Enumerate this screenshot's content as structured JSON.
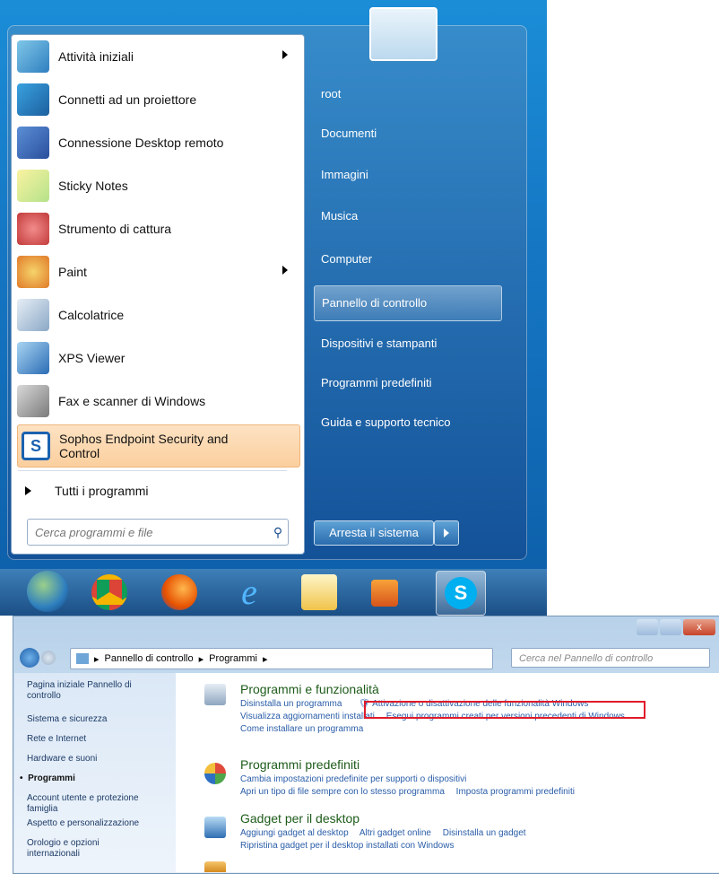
{
  "start_menu": {
    "programs": [
      {
        "label": "Attività iniziali",
        "submenu": true
      },
      {
        "label": "Connetti ad un proiettore",
        "submenu": false
      },
      {
        "label": "Connessione Desktop remoto",
        "submenu": false
      },
      {
        "label": "Sticky Notes",
        "submenu": false
      },
      {
        "label": "Strumento di cattura",
        "submenu": false
      },
      {
        "label": "Paint",
        "submenu": true
      },
      {
        "label": "Calcolatrice",
        "submenu": false
      },
      {
        "label": "XPS Viewer",
        "submenu": false
      },
      {
        "label": "Fax e scanner di Windows",
        "submenu": false
      },
      {
        "label": "Sophos Endpoint Security and Control",
        "submenu": false
      }
    ],
    "all_programs_label": "Tutti i programmi",
    "search_placeholder": "Cerca programmi e file",
    "right_items": [
      "root",
      "Documenti",
      "Immagini",
      "Musica",
      "Computer",
      "Pannello di controllo",
      "Dispositivi e stampanti",
      "Programmi predefiniti",
      "Guida e supporto tecnico"
    ],
    "shutdown_label": "Arresta il sistema"
  },
  "taskbar": {
    "icons": [
      "start-orb-icon",
      "chrome-icon",
      "firefox-icon",
      "internet-explorer-icon",
      "file-explorer-icon",
      "media-player-icon",
      "skype-icon"
    ]
  },
  "control_panel": {
    "breadcrumb": [
      "Pannello di controllo",
      "Programmi"
    ],
    "search_placeholder": "Cerca nel Pannello di controllo",
    "sidebar": {
      "home": "Pagina iniziale Pannello di controllo",
      "items": [
        "Sistema e sicurezza",
        "Rete e Internet",
        "Hardware e suoni",
        "Programmi",
        "Account utente e protezione famiglia",
        "Aspetto e personalizzazione",
        "Orologio e opzioni internazionali"
      ],
      "active": "Programmi"
    },
    "categories": [
      {
        "title": "Programmi e funzionalità",
        "links": [
          "Disinstalla un programma",
          "Attivazione o disattivazione delle funzionalità Windows",
          "Visualizza aggiornamenti installati",
          "Esegui programmi creati per versioni precedenti di Windows",
          "Come installare un programma"
        ]
      },
      {
        "title": "Programmi predefiniti",
        "links": [
          "Cambia impostazioni predefinite per supporti o dispositivi",
          "Apri un tipo di file sempre con lo stesso programma",
          "Imposta programmi predefiniti"
        ]
      },
      {
        "title": "Gadget per il desktop",
        "links": [
          "Aggiungi gadget al desktop",
          "Altri gadget online",
          "Disinstalla un gadget",
          "Ripristina gadget per il desktop installati con Windows"
        ]
      }
    ]
  },
  "colors": {
    "highlight_box": "#e01b2a",
    "link": "#2a5da8",
    "category_title": "#1e5c1a"
  }
}
